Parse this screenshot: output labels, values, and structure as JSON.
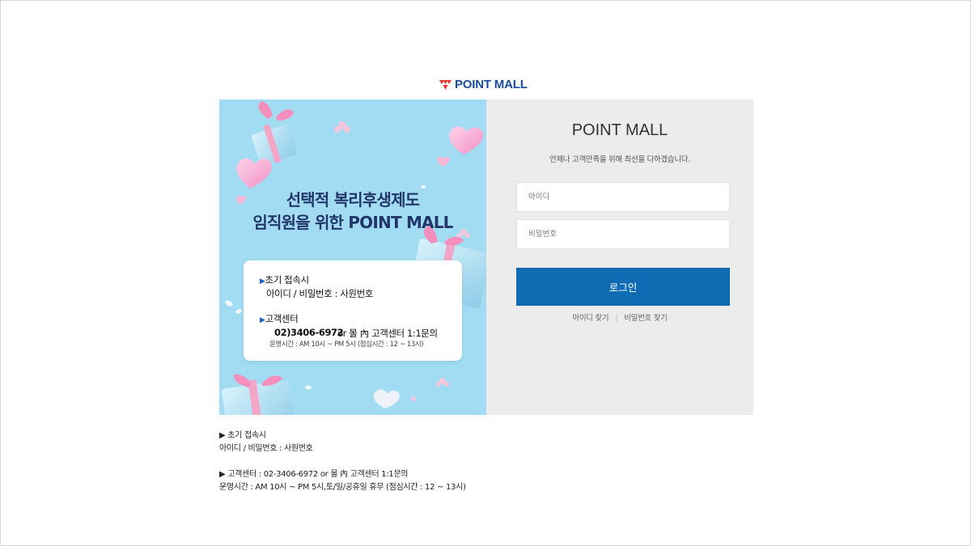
{
  "logo": {
    "text": "POINT MALL"
  },
  "banner": {
    "headline_1": "선택적 복리후생제도",
    "headline_2": "임직원을 위한 POINT MALL",
    "card": {
      "first_access_title": "초기 접속시",
      "first_access_desc": "아이디 / 비밀번호 : 사원번호",
      "support_title": "고객센터",
      "support_phone": "02)3406-6972",
      "support_or": "or 몰 內 고객센터 1:1문의",
      "support_hours": "운영시간 : AM 10시 ~ PM 5시 (점심시간 : 12 ~ 13시)"
    }
  },
  "login": {
    "title": "POINT MALL",
    "subtitle": "언제나 고객만족을 위해 최선을 다하겠습니다.",
    "id_placeholder": "아이디",
    "pw_placeholder": "비밀번호",
    "login_button": "로그인",
    "find_id": "아이디 찾기",
    "separator": "|",
    "find_pw": "비밀번호 찾기"
  },
  "footer_info": {
    "line1": "▶ 초기 접속시",
    "line2": "아이디 / 비밀번호 : 사원번호",
    "line3": "▶ 고객센터 : 02-3406-6972 or 몰 內 고객센터 1:1문의",
    "line4": "운영시간 : AM 10시 ~ PM 5시,토/일/공휴일 휴무 (점심시간 : 12 ~ 13시)"
  },
  "colors": {
    "brand_blue": "#0f6cb3",
    "logo_red": "#e8322a",
    "banner_bg": "#a2dcf3",
    "panel_bg": "#ececec"
  },
  "icons": {
    "logo": "point-mall-logo-icon"
  }
}
